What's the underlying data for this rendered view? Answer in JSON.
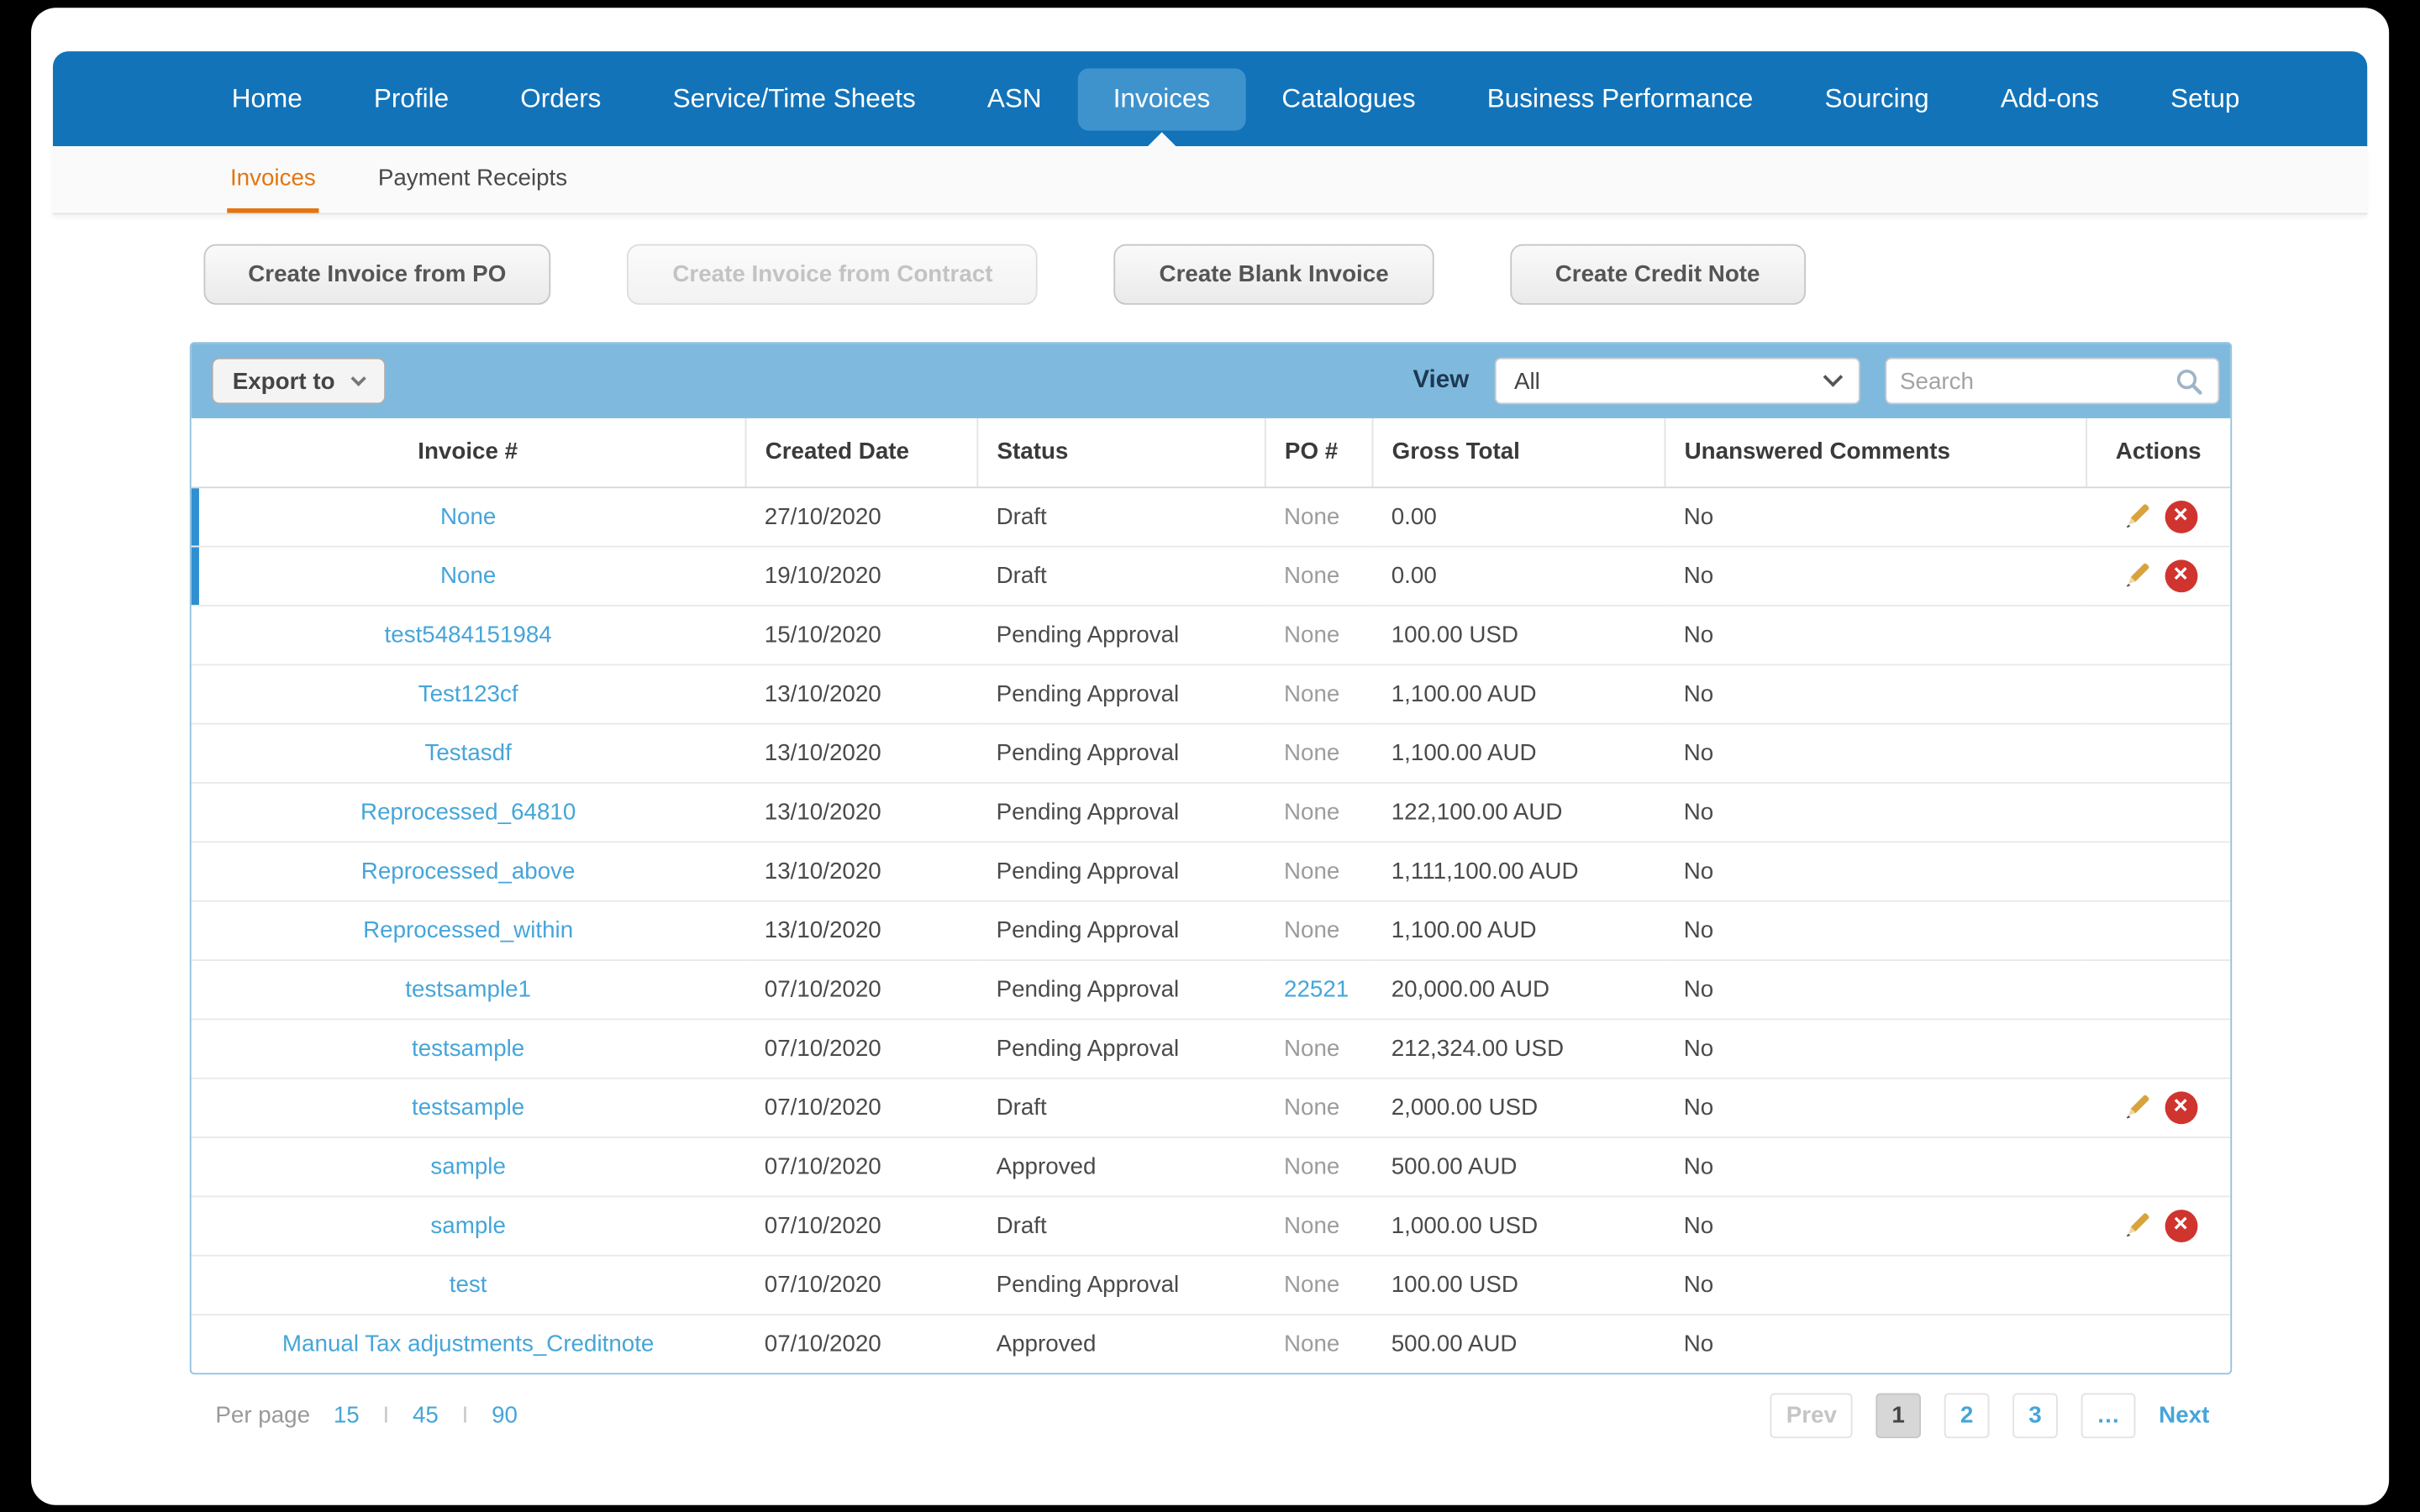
{
  "colors": {
    "nav_bg": "#1273b9",
    "nav_active_bg": "#3f93cd",
    "subnav_accent": "#e4750f",
    "toolbar_bg": "#7fbade",
    "link": "#46a5d9",
    "delete_red": "#d0342f",
    "pencil_gold": "#d8a33c",
    "row_indicator": "#2e8fd1"
  },
  "icons": {
    "dropdown": "chevron-down",
    "search": "magnifier",
    "edit": "pencil",
    "delete": "red-circle-x",
    "delete_glyph": "×"
  },
  "nav": {
    "items": [
      "Home",
      "Profile",
      "Orders",
      "Service/Time Sheets",
      "ASN",
      "Invoices",
      "Catalogues",
      "Business Performance",
      "Sourcing",
      "Add-ons",
      "Setup"
    ],
    "active": "Invoices"
  },
  "subnav": {
    "items": [
      {
        "label": "Invoices",
        "active": true
      },
      {
        "label": "Payment Receipts",
        "active": false
      }
    ]
  },
  "action_buttons": [
    {
      "label": "Create Invoice from PO",
      "disabled": false
    },
    {
      "label": "Create Invoice from Contract",
      "disabled": true
    },
    {
      "label": "Create Blank Invoice",
      "disabled": false
    },
    {
      "label": "Create Credit Note",
      "disabled": false
    }
  ],
  "toolbar": {
    "export_button": "Export to",
    "view_label": "View",
    "view_selected": "All",
    "search_placeholder": "Search"
  },
  "table": {
    "columns": [
      "Invoice #",
      "Created Date",
      "Status",
      "PO #",
      "Gross Total",
      "Unanswered Comments",
      "Actions"
    ],
    "rows": [
      {
        "invoice": "None",
        "created": "27/10/2020",
        "status": "Draft",
        "po": "None",
        "po_is_link": false,
        "gross": "0.00",
        "comments": "No",
        "has_actions": true,
        "highlighted": true
      },
      {
        "invoice": "None",
        "created": "19/10/2020",
        "status": "Draft",
        "po": "None",
        "po_is_link": false,
        "gross": "0.00",
        "comments": "No",
        "has_actions": true,
        "highlighted": true
      },
      {
        "invoice": "test5484151984",
        "created": "15/10/2020",
        "status": "Pending Approval",
        "po": "None",
        "po_is_link": false,
        "gross": "100.00 USD",
        "comments": "No",
        "has_actions": false,
        "highlighted": false
      },
      {
        "invoice": "Test123cf",
        "created": "13/10/2020",
        "status": "Pending Approval",
        "po": "None",
        "po_is_link": false,
        "gross": "1,100.00 AUD",
        "comments": "No",
        "has_actions": false,
        "highlighted": false
      },
      {
        "invoice": "Testasdf",
        "created": "13/10/2020",
        "status": "Pending Approval",
        "po": "None",
        "po_is_link": false,
        "gross": "1,100.00 AUD",
        "comments": "No",
        "has_actions": false,
        "highlighted": false
      },
      {
        "invoice": "Reprocessed_64810",
        "created": "13/10/2020",
        "status": "Pending Approval",
        "po": "None",
        "po_is_link": false,
        "gross": "122,100.00 AUD",
        "comments": "No",
        "has_actions": false,
        "highlighted": false
      },
      {
        "invoice": "Reprocessed_above",
        "created": "13/10/2020",
        "status": "Pending Approval",
        "po": "None",
        "po_is_link": false,
        "gross": "1,111,100.00 AUD",
        "comments": "No",
        "has_actions": false,
        "highlighted": false
      },
      {
        "invoice": "Reprocessed_within",
        "created": "13/10/2020",
        "status": "Pending Approval",
        "po": "None",
        "po_is_link": false,
        "gross": "1,100.00 AUD",
        "comments": "No",
        "has_actions": false,
        "highlighted": false
      },
      {
        "invoice": "testsample1",
        "created": "07/10/2020",
        "status": "Pending Approval",
        "po": "22521",
        "po_is_link": true,
        "gross": "20,000.00 AUD",
        "comments": "No",
        "has_actions": false,
        "highlighted": false
      },
      {
        "invoice": "testsample",
        "created": "07/10/2020",
        "status": "Pending Approval",
        "po": "None",
        "po_is_link": false,
        "gross": "212,324.00 USD",
        "comments": "No",
        "has_actions": false,
        "highlighted": false
      },
      {
        "invoice": "testsample",
        "created": "07/10/2020",
        "status": "Draft",
        "po": "None",
        "po_is_link": false,
        "gross": "2,000.00 USD",
        "comments": "No",
        "has_actions": true,
        "highlighted": false
      },
      {
        "invoice": "sample",
        "created": "07/10/2020",
        "status": "Approved",
        "po": "None",
        "po_is_link": false,
        "gross": "500.00 AUD",
        "comments": "No",
        "has_actions": false,
        "highlighted": false
      },
      {
        "invoice": "sample",
        "created": "07/10/2020",
        "status": "Draft",
        "po": "None",
        "po_is_link": false,
        "gross": "1,000.00 USD",
        "comments": "No",
        "has_actions": true,
        "highlighted": false
      },
      {
        "invoice": "test",
        "created": "07/10/2020",
        "status": "Pending Approval",
        "po": "None",
        "po_is_link": false,
        "gross": "100.00 USD",
        "comments": "No",
        "has_actions": false,
        "highlighted": false
      },
      {
        "invoice": "Manual Tax adjustments_Creditnote",
        "created": "07/10/2020",
        "status": "Approved",
        "po": "None",
        "po_is_link": false,
        "gross": "500.00 AUD",
        "comments": "No",
        "has_actions": false,
        "highlighted": false
      }
    ]
  },
  "footer": {
    "per_page_label": "Per page",
    "per_page_options": [
      "15",
      "45",
      "90"
    ],
    "separator": "I",
    "pagination": {
      "prev_label": "Prev",
      "pages": [
        "1",
        "2",
        "3",
        "…"
      ],
      "active_page": "1",
      "next_label": "Next"
    }
  }
}
